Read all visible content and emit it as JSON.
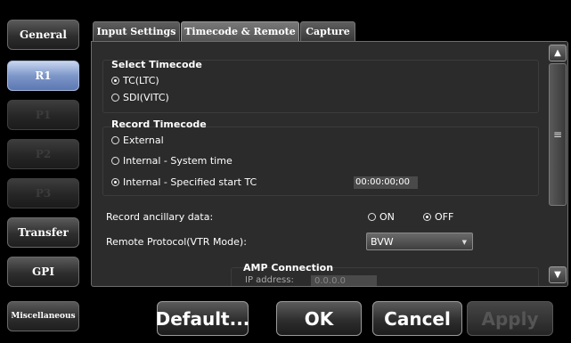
{
  "sidebar": {
    "items": [
      {
        "label": "General"
      },
      {
        "label": "R1"
      },
      {
        "label": "P1"
      },
      {
        "label": "P2"
      },
      {
        "label": "P3"
      },
      {
        "label": "Transfer"
      },
      {
        "label": "GPI"
      },
      {
        "label": "Miscellaneous"
      }
    ]
  },
  "tabs": [
    {
      "label": "Input Settings"
    },
    {
      "label": "Timecode & Remote"
    },
    {
      "label": "Capture"
    }
  ],
  "select_timecode": {
    "title": "Select Timecode",
    "options": [
      {
        "label": "TC(LTC)",
        "selected": true
      },
      {
        "label": "SDI(VITC)",
        "selected": false
      }
    ]
  },
  "record_timecode": {
    "title": "Record Timecode",
    "options": [
      {
        "label": "External",
        "selected": false
      },
      {
        "label": "Internal - System time",
        "selected": false
      },
      {
        "label": "Internal - Specified start TC",
        "selected": true
      }
    ],
    "start_tc": "00:00:00;00"
  },
  "ancillary": {
    "label": "Record ancillary data:",
    "on_label": "ON",
    "off_label": "OFF",
    "value": "OFF"
  },
  "remote_protocol": {
    "label": "Remote Protocol(VTR Mode):",
    "value": "BVW"
  },
  "amp": {
    "title": "AMP Connection",
    "ip_label": "IP address:",
    "ip_value": "0.0.0.0"
  },
  "scrollbar": {
    "up_icon": "up-arrow-icon",
    "down_icon": "down-arrow-icon",
    "grip_icon": "grip-icon"
  },
  "footer": {
    "default_label": "Default...",
    "ok_label": "OK",
    "cancel_label": "Cancel",
    "apply_label": "Apply"
  },
  "colors": {
    "accent": "#7d97c9",
    "background": "#000000",
    "panel": "#2c2c2c"
  }
}
